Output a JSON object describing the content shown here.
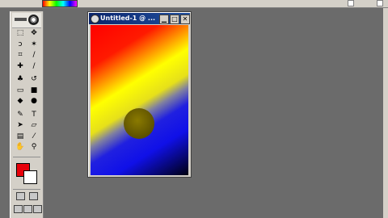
{
  "document": {
    "title": "Untitled-1 @ ...",
    "close_glyph": "✕",
    "minimize_glyph": "▁",
    "maximize_glyph": "□"
  },
  "toolbox": {
    "logo_glyph": "◉",
    "tools": [
      {
        "name": "marquee-tool",
        "glyph": "⬚"
      },
      {
        "name": "move-tool",
        "glyph": "✥"
      },
      {
        "name": "lasso-tool",
        "glyph": "ↄ"
      },
      {
        "name": "magic-wand-tool",
        "glyph": "✶"
      },
      {
        "name": "crop-tool",
        "glyph": "⌗"
      },
      {
        "name": "slice-tool",
        "glyph": "∕"
      },
      {
        "name": "healing-brush-tool",
        "glyph": "✚"
      },
      {
        "name": "brush-tool",
        "glyph": "∕"
      },
      {
        "name": "clone-stamp-tool",
        "glyph": "♣"
      },
      {
        "name": "history-brush-tool",
        "glyph": "↺"
      },
      {
        "name": "eraser-tool",
        "glyph": "▭"
      },
      {
        "name": "gradient-tool",
        "glyph": "■"
      },
      {
        "name": "blur-tool",
        "glyph": "◆"
      },
      {
        "name": "dodge-tool",
        "glyph": "●"
      },
      {
        "name": "pen-tool",
        "glyph": "✎"
      },
      {
        "name": "type-tool",
        "glyph": "T"
      },
      {
        "name": "path-selection-tool",
        "glyph": "➤"
      },
      {
        "name": "shape-tool",
        "glyph": "▱"
      },
      {
        "name": "notes-tool",
        "glyph": "▤"
      },
      {
        "name": "eyedropper-tool",
        "glyph": "⁄"
      },
      {
        "name": "hand-tool",
        "glyph": "✋"
      },
      {
        "name": "zoom-tool",
        "glyph": "⚲"
      }
    ],
    "foreground_color": "#e8000a",
    "background_color": "#ffffff"
  },
  "colors": {
    "workspace": "#6b6b6b",
    "titlebar": "#0a246a",
    "chrome": "#d4d0c8"
  }
}
